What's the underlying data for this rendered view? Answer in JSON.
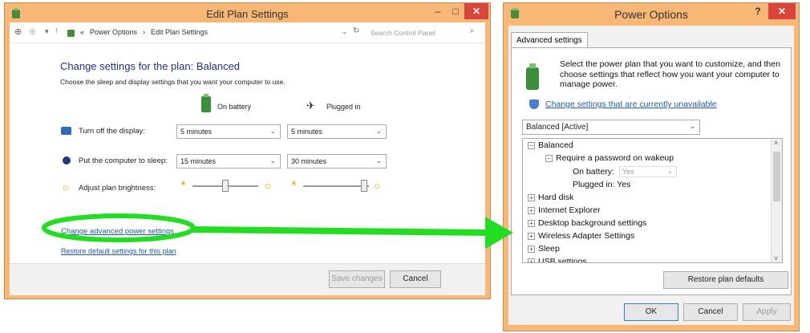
{
  "left_window": {
    "title": "Edit Plan Settings",
    "address": {
      "path_prefix": "«",
      "crumb1": "Power Options",
      "sep": "›",
      "crumb2": "Edit Plan Settings",
      "search_placeholder": "Search Control Panel"
    },
    "heading": "Change settings for the plan: Balanced",
    "subheading": "Choose the sleep and display settings that you want your computer to use.",
    "col_battery": "On battery",
    "col_plugged": "Plugged in",
    "rows": [
      {
        "label": "Turn off the display:",
        "battery": "5 minutes",
        "plugged": "5 minutes"
      },
      {
        "label": "Put the computer to sleep:",
        "battery": "15 minutes",
        "plugged": "30 minutes"
      },
      {
        "label": "Adjust plan brightness:"
      }
    ],
    "brightness": {
      "battery_level": 0.5,
      "plugged_level": 1.0
    },
    "link_advanced": "Change advanced power settings",
    "link_restore": "Restore default settings for this plan",
    "save_button": "Save changes",
    "cancel_button": "Cancel"
  },
  "right_window": {
    "title": "Power Options",
    "help_label": "?",
    "close_label": "✕",
    "tab": "Advanced settings",
    "intro": "Select the power plan that you want to customize, and then choose settings that reflect how you want your computer to manage power.",
    "link_unavailable": "Change settings that are currently unavailable",
    "plan_select": "Balanced [Active]",
    "tree": {
      "root": "Balanced",
      "child": "Require a password on wakeup",
      "on_battery_label": "On battery:",
      "on_battery_value": "Yes",
      "plugged_label": "Plugged in:",
      "plugged_value": "Yes",
      "items": [
        "Hard disk",
        "Internet Explorer",
        "Desktop background settings",
        "Wireless Adapter Settings",
        "Sleep",
        "USB settings"
      ]
    },
    "restore_button": "Restore plan defaults",
    "ok_button": "OK",
    "cancel_button": "Cancel",
    "apply_button": "Apply"
  },
  "colors": {
    "frame": "#f8b775",
    "close": "#d9443b",
    "highlight": "#22dd22",
    "link": "#1f5aa6"
  }
}
